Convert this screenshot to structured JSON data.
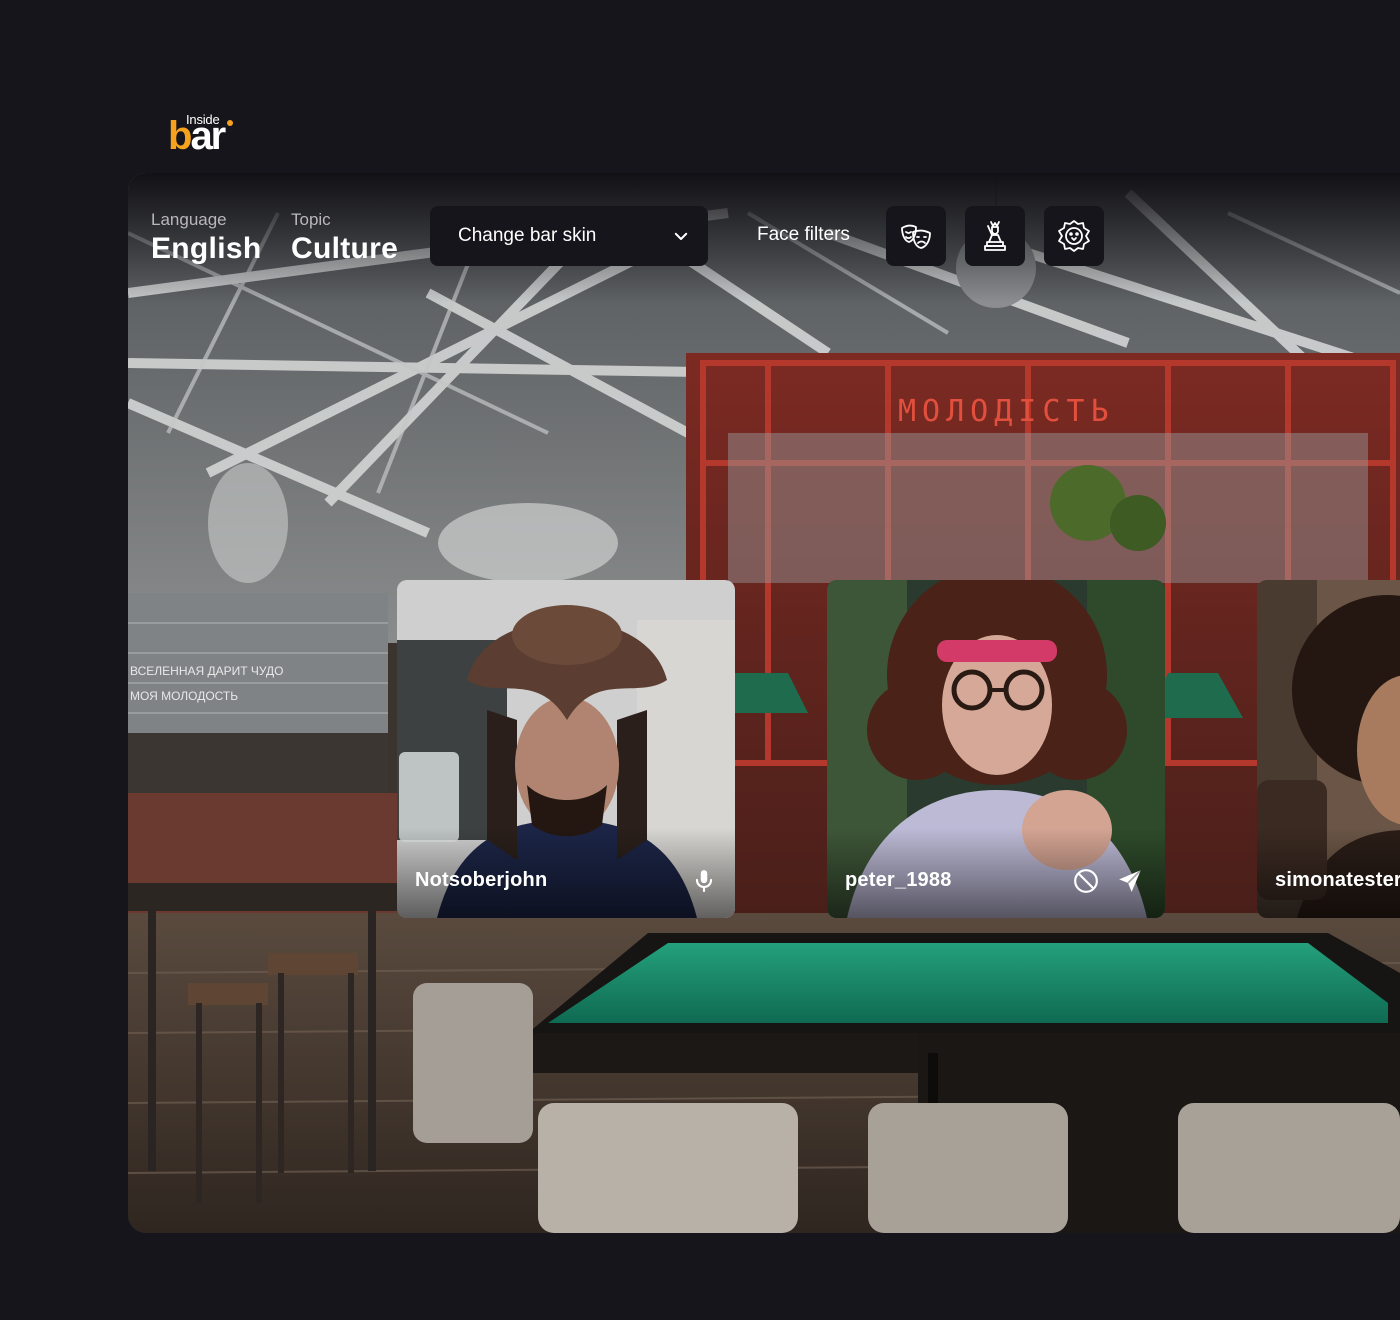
{
  "brand": {
    "inside": "Inside",
    "b": "b",
    "ar": "ar",
    "accent": "#f6a21d"
  },
  "topbar": {
    "language": {
      "label": "Language",
      "value": "English"
    },
    "topic": {
      "label": "Topic",
      "value": "Culture"
    },
    "skin_select": {
      "label": "Change bar skin",
      "icon": "chevron-down-icon"
    },
    "face_filters": {
      "label": "Face filters",
      "buttons": [
        {
          "icon": "theater-masks-icon"
        },
        {
          "icon": "statue-icon"
        },
        {
          "icon": "lion-face-icon"
        }
      ]
    }
  },
  "scene": {
    "sign_text": "МОЛОДІСТЬ",
    "wall_text_1": "ВСЕЛЕННАЯ ДАРИТ ЧУДО",
    "wall_text_2": "МОЯ МОЛОДОСТЬ"
  },
  "participants": [
    {
      "name": "Notsoberjohn",
      "actions": [
        "microphone-icon"
      ]
    },
    {
      "name": "peter_1988",
      "actions": [
        "block-icon",
        "send-icon"
      ]
    },
    {
      "name": "simonatester",
      "actions": []
    }
  ],
  "colors": {
    "page_bg": "#16151c",
    "panel_bg": "#16151b",
    "table_green": "#1e8a6a",
    "sign_red": "#d43a2c"
  }
}
